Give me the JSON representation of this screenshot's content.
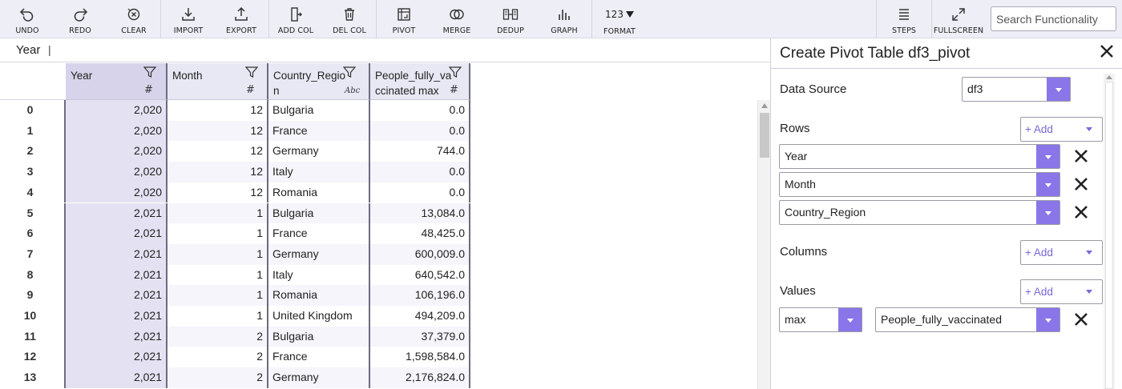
{
  "toolbar": {
    "buttons": [
      {
        "label": "UNDO",
        "icon": "undo-icon"
      },
      {
        "label": "REDO",
        "icon": "redo-icon"
      },
      {
        "label": "CLEAR",
        "icon": "clear-icon"
      },
      {
        "label": "IMPORT",
        "icon": "import-icon"
      },
      {
        "label": "EXPORT",
        "icon": "export-icon"
      },
      {
        "label": "ADD COL",
        "icon": "add-column-icon"
      },
      {
        "label": "DEL COL",
        "icon": "trash-icon"
      },
      {
        "label": "PIVOT",
        "icon": "pivot-icon"
      },
      {
        "label": "MERGE",
        "icon": "merge-icon"
      },
      {
        "label": "DEDUP",
        "icon": "dedup-icon"
      },
      {
        "label": "GRAPH",
        "icon": "bar-chart-icon"
      },
      {
        "label": "FORMAT",
        "icon": "format-icon",
        "top_text": "123"
      },
      {
        "label": "STEPS",
        "icon": "steps-icon"
      },
      {
        "label": "FULLSCREEN",
        "icon": "fullscreen-icon"
      }
    ],
    "search_placeholder": "Search Functionality"
  },
  "column_bar": {
    "name": "Year",
    "caret": "|"
  },
  "grid": {
    "columns": [
      {
        "title_line1": "Year",
        "title_line2": "",
        "type": "#"
      },
      {
        "title_line1": "Month",
        "title_line2": "",
        "type": "#"
      },
      {
        "title_line1": "Country_Regio",
        "title_line2": "n",
        "type": "Abc"
      },
      {
        "title_line1": "People_fully_va",
        "title_line2": "ccinated max",
        "type": "#"
      }
    ],
    "rows": [
      {
        "idx": "0",
        "year": "2,020",
        "month": "12",
        "country": "Bulgaria",
        "people": "0.0"
      },
      {
        "idx": "1",
        "year": "2,020",
        "month": "12",
        "country": "France",
        "people": "0.0"
      },
      {
        "idx": "2",
        "year": "2,020",
        "month": "12",
        "country": "Germany",
        "people": "744.0"
      },
      {
        "idx": "3",
        "year": "2,020",
        "month": "12",
        "country": "Italy",
        "people": "0.0"
      },
      {
        "idx": "4",
        "year": "2,020",
        "month": "12",
        "country": "Romania",
        "people": "0.0"
      },
      {
        "idx": "5",
        "year": "2,021",
        "month": "1",
        "country": "Bulgaria",
        "people": "13,084.0"
      },
      {
        "idx": "6",
        "year": "2,021",
        "month": "1",
        "country": "France",
        "people": "48,425.0"
      },
      {
        "idx": "7",
        "year": "2,021",
        "month": "1",
        "country": "Germany",
        "people": "600,009.0"
      },
      {
        "idx": "8",
        "year": "2,021",
        "month": "1",
        "country": "Italy",
        "people": "640,542.0"
      },
      {
        "idx": "9",
        "year": "2,021",
        "month": "1",
        "country": "Romania",
        "people": "106,196.0"
      },
      {
        "idx": "10",
        "year": "2,021",
        "month": "1",
        "country": "United Kingdom",
        "people": "494,209.0"
      },
      {
        "idx": "11",
        "year": "2,021",
        "month": "2",
        "country": "Bulgaria",
        "people": "37,379.0"
      },
      {
        "idx": "12",
        "year": "2,021",
        "month": "2",
        "country": "France",
        "people": "1,598,584.0"
      },
      {
        "idx": "13",
        "year": "2,021",
        "month": "2",
        "country": "Germany",
        "people": "2,176,824.0"
      }
    ]
  },
  "pivot": {
    "title": "Create Pivot Table df3_pivot",
    "data_source_label": "Data Source",
    "data_source_value": "df3",
    "rows_label": "Rows",
    "rows": [
      "Year",
      "Month",
      "Country_Region"
    ],
    "columns_label": "Columns",
    "values_label": "Values",
    "values_agg": "max",
    "values_field": "People_fully_vaccinated",
    "add_label": "+ Add"
  },
  "colors": {
    "accent": "#8a76e8",
    "toolbar_bg": "#eeeef6",
    "header_bg": "#e8e8f4",
    "selected_col": "#d6d3ea"
  }
}
